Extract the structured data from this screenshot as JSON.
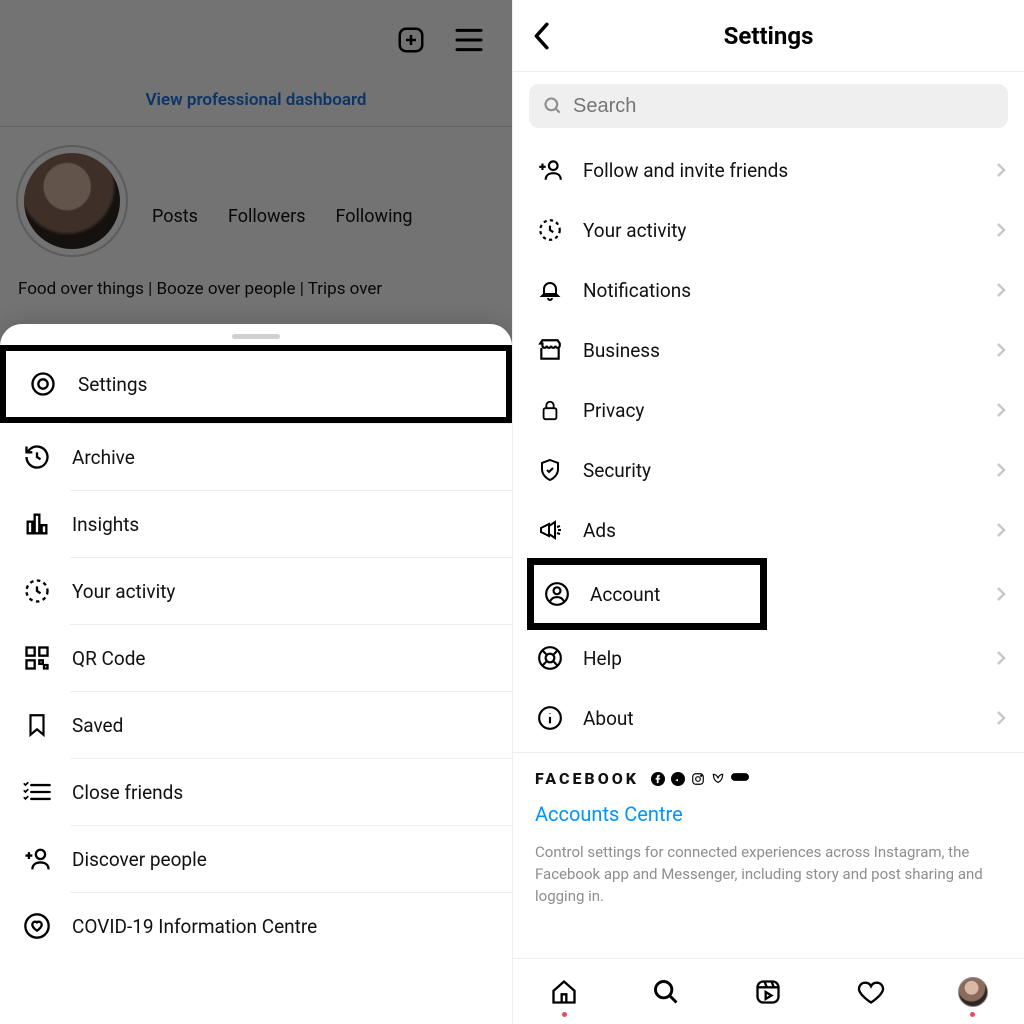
{
  "left": {
    "dashboard_link": "View professional dashboard",
    "stats": {
      "posts": "Posts",
      "followers": "Followers",
      "following": "Following"
    },
    "bio": "Food over things | Booze over people | Trips over",
    "menu": [
      {
        "label": "Settings",
        "highlight": true
      },
      {
        "label": "Archive"
      },
      {
        "label": "Insights"
      },
      {
        "label": "Your activity"
      },
      {
        "label": "QR Code"
      },
      {
        "label": "Saved"
      },
      {
        "label": "Close friends"
      },
      {
        "label": "Discover people"
      },
      {
        "label": "COVID-19 Information Centre"
      }
    ]
  },
  "right": {
    "title": "Settings",
    "search_placeholder": "Search",
    "items": [
      {
        "label": "Follow and invite friends"
      },
      {
        "label": "Your activity"
      },
      {
        "label": "Notifications"
      },
      {
        "label": "Business"
      },
      {
        "label": "Privacy"
      },
      {
        "label": "Security"
      },
      {
        "label": "Ads"
      },
      {
        "label": "Account",
        "highlight": true
      },
      {
        "label": "Help"
      },
      {
        "label": "About"
      }
    ],
    "facebook_label": "FACEBOOK",
    "accounts_centre": "Accounts Centre",
    "accounts_desc": "Control settings for connected experiences across Instagram, the Facebook app and Messenger, including story and post sharing and logging in."
  }
}
